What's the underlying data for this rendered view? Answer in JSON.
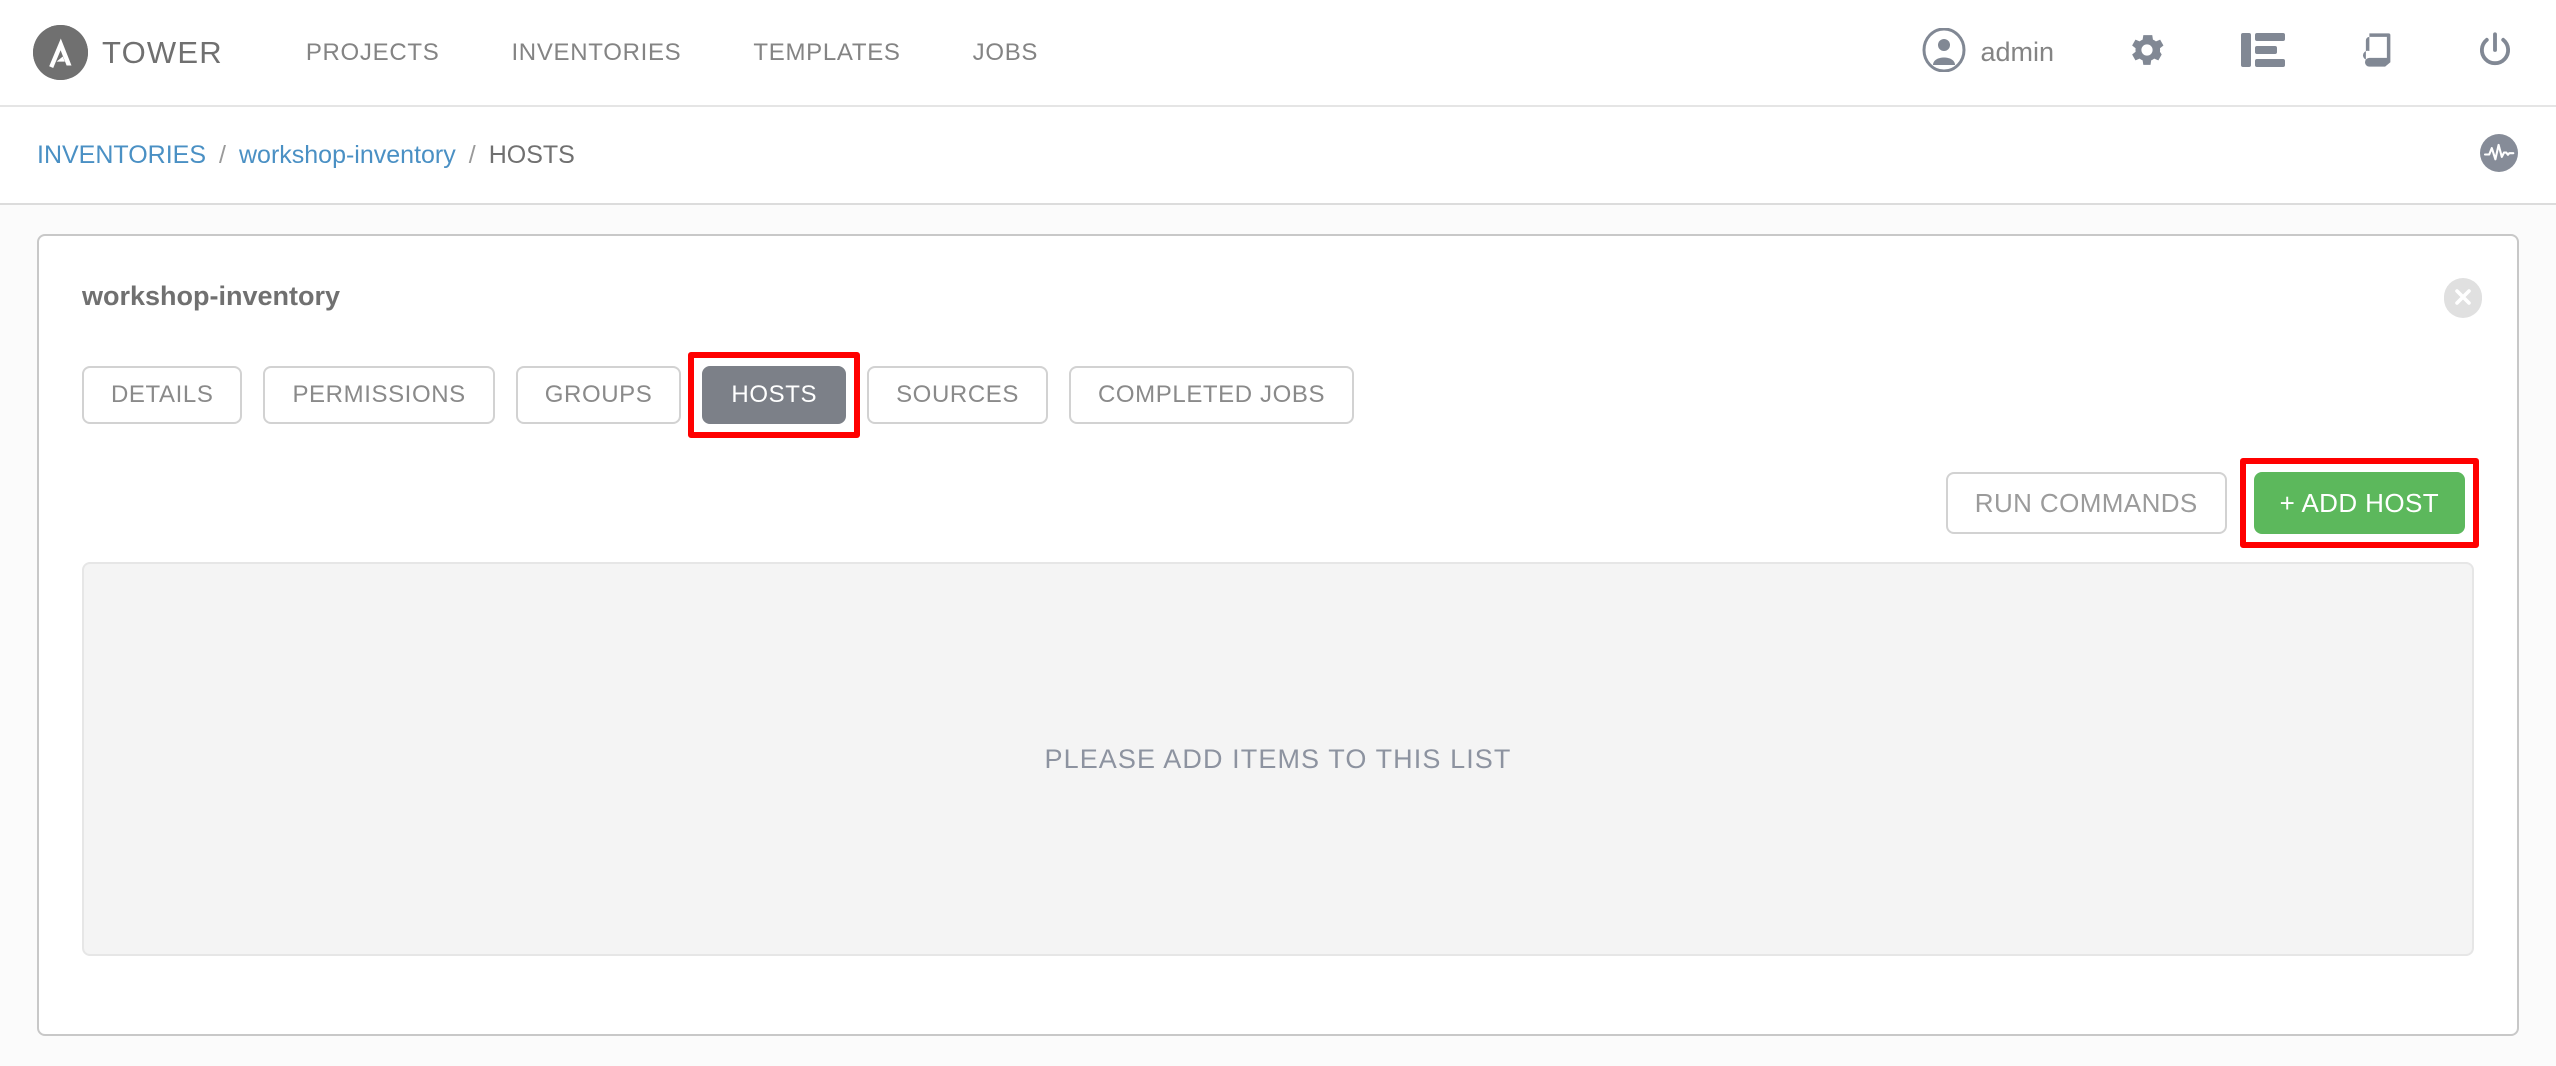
{
  "topbar": {
    "brand_name": "TOWER",
    "brand_logo_icon": "ansible-a-logo-icon",
    "nav": [
      {
        "label": "PROJECTS"
      },
      {
        "label": "INVENTORIES"
      },
      {
        "label": "TEMPLATES"
      },
      {
        "label": "JOBS"
      }
    ],
    "user_name": "admin",
    "user_icon": "user-avatar-icon",
    "icons": [
      {
        "name": "gear-icon"
      },
      {
        "name": "server-list-icon"
      },
      {
        "name": "book-icon"
      },
      {
        "name": "power-icon"
      }
    ]
  },
  "breadcrumb": {
    "items": [
      {
        "label": "INVENTORIES",
        "type": "link"
      },
      {
        "label": "workshop-inventory",
        "type": "link"
      },
      {
        "label": "HOSTS",
        "type": "current"
      }
    ],
    "separator": "/",
    "activity_stream_icon": "activity-stream-pulse-icon"
  },
  "card": {
    "title": "workshop-inventory",
    "close_icon": "close-circle-icon",
    "tabs": [
      {
        "label": "DETAILS",
        "active": false,
        "highlighted": false
      },
      {
        "label": "PERMISSIONS",
        "active": false,
        "highlighted": false
      },
      {
        "label": "GROUPS",
        "active": false,
        "highlighted": false
      },
      {
        "label": "HOSTS",
        "active": true,
        "highlighted": true
      },
      {
        "label": "SOURCES",
        "active": false,
        "highlighted": false
      },
      {
        "label": "COMPLETED JOBS",
        "active": false,
        "highlighted": false
      }
    ],
    "run_commands_label": "RUN COMMANDS",
    "add_host_label": "+ ADD HOST",
    "empty_list_message": "PLEASE ADD ITEMS TO THIS LIST"
  },
  "colors": {
    "accent_blue": "#4a90c4",
    "add_button_green": "#5cb85c",
    "active_tab_gray": "#7c8088",
    "annotation_red": "#ff0000",
    "text_gray": "#848484"
  }
}
